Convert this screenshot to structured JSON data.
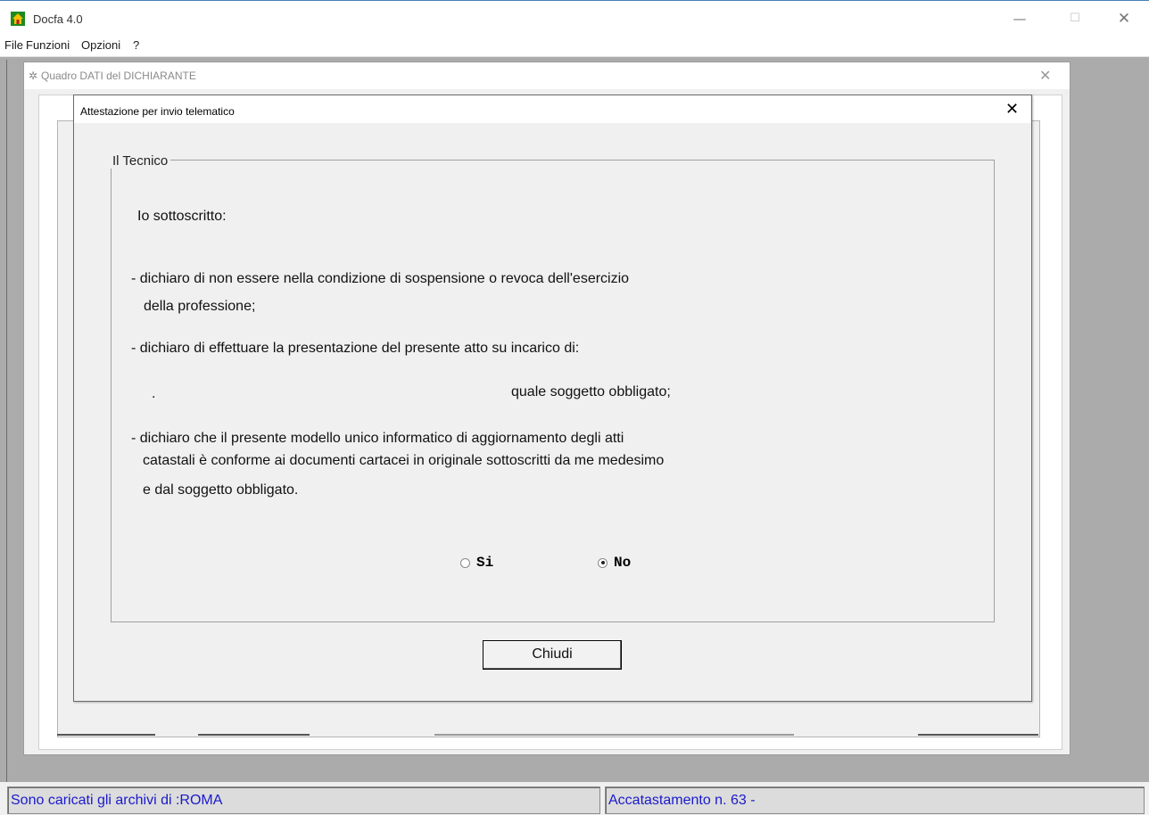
{
  "app": {
    "title": "Docfa 4.0",
    "window_controls": {
      "minimize": "—",
      "maximize": "☐",
      "close": "✕"
    }
  },
  "menu": {
    "items": [
      "File",
      "Funzioni",
      "Opzioni",
      "?"
    ]
  },
  "quadro": {
    "title": "Quadro DATI del DICHIARANTE"
  },
  "dialog": {
    "title": "Attestazione per invio telematico",
    "group_label": "Il Tecnico",
    "lines": {
      "intro": "Io sottoscritto:",
      "p1a": "- dichiaro di non essere nella condizione di sospensione o revoca dell'esercizio",
      "p1b": "della professione;",
      "p2": "- dichiaro di effettuare la presentazione del presente atto su incarico di:",
      "dot": ".",
      "obbligato": "quale soggetto obbligato;",
      "p3a": "- dichiaro che il presente modello unico informatico di aggiornamento degli atti",
      "p3b": "catastali è conforme ai documenti cartacei in originale sottoscritti da me medesimo",
      "p3c": "e dal soggetto obbligato."
    },
    "radio": {
      "si_label": "Si",
      "no_label": "No",
      "selected": "No"
    },
    "close_button": "Chiudi"
  },
  "status": {
    "left": "Sono caricati gli archivi di :ROMA",
    "right": "Accatastamento n.  63 -"
  },
  "colors": {
    "status_text": "#1a1acc",
    "workspace": "#ababab",
    "dialog_bg": "#f0f0f0"
  }
}
